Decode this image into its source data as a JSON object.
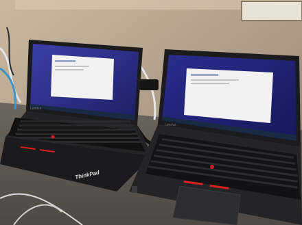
{
  "scene": {
    "left_laptop": {
      "screen_content": "Windows setup window over blue background",
      "palmrest_brand": "ThinkPad",
      "bezel_logo": "Lenovo",
      "trackpoint_color": "#d8211f",
      "taskbar_color": "#1a2a44"
    },
    "right_laptop": {
      "screen_content": "Windows setup window over blue background",
      "bezel_logo": "Lenovo",
      "trackpoint_color": "#d8211f",
      "taskbar_color": "#1a2a44"
    },
    "colors": {
      "wall": "#b7a791",
      "desk": "#5f5a54",
      "screen_blue": "#2d2f8a",
      "window_white": "#f2f2f2",
      "laptop_black": "#1b1b1d"
    }
  }
}
